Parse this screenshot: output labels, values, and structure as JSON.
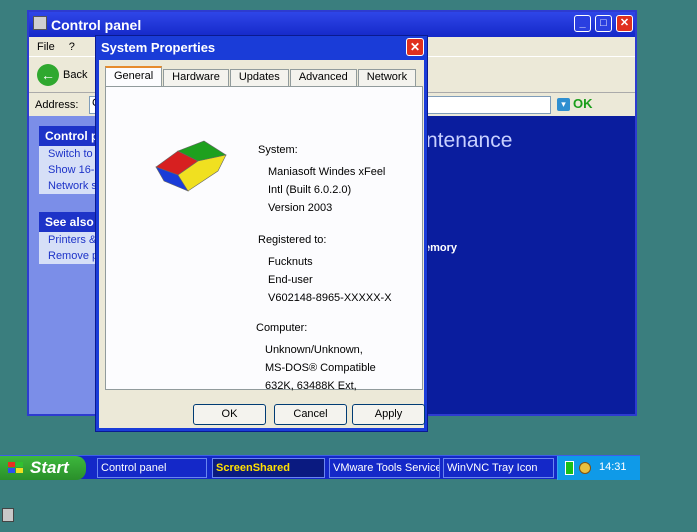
{
  "control_panel": {
    "title": "Control panel",
    "menu": [
      "File",
      "?"
    ],
    "back_label": "Back",
    "address_label": "Address:",
    "address_value": "C",
    "go_label": "OK",
    "control_pane_heading": "Control p",
    "control_pane_items": [
      "Switch to",
      "Show 16-",
      "Network s"
    ],
    "see_also_heading": "See also",
    "see_also_items": [
      "Printers &",
      "Remove p"
    ],
    "main_heading": "ntenance",
    "main_link": "emory"
  },
  "dialog": {
    "title": "System Properties",
    "tabs": [
      "General",
      "Hardware",
      "Updates",
      "Advanced",
      "Network"
    ],
    "system_label": "System:",
    "system_lines": [
      "Maniasoft Windes xFeel",
      "Intl (Built 6.0.2.0)",
      "Version 2003"
    ],
    "registered_label": "Registered to:",
    "registered_lines": [
      "Fucknuts",
      "End-user",
      "V602148-8965-XXXXX-X"
    ],
    "computer_label": "Computer:",
    "computer_lines": [
      "Unknown/Unknown,",
      "MS-DOS® Compatible",
      "632K, 63488K Ext,"
    ],
    "buttons": {
      "ok": "OK",
      "cancel": "Cancel",
      "apply": "Apply"
    }
  },
  "taskbar": {
    "start_label": "Start",
    "tasks": [
      "Control panel",
      "ScreenShared",
      "VMware Tools Service",
      "WinVNC Tray Icon"
    ],
    "active_task": "ScreenShared",
    "clock": "14:31"
  },
  "icons": [
    "window-app-icon",
    "minimize-icon",
    "maximize-icon",
    "close-icon",
    "back-arrow-icon",
    "go-arrow-icon",
    "windows-flag-logo",
    "battery-icon",
    "speaker-icon"
  ]
}
